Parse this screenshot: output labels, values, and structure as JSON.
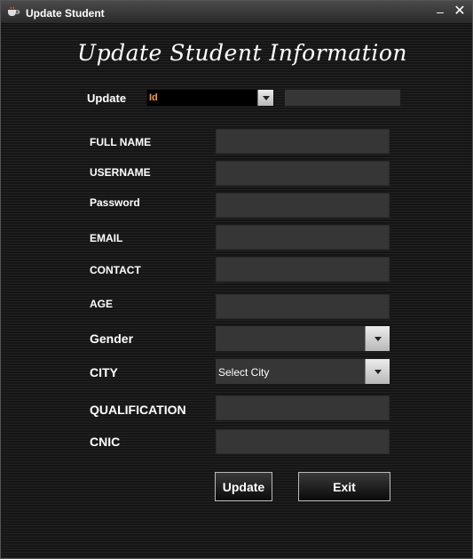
{
  "window": {
    "title": "Update Student",
    "minimize_glyph": "–",
    "close_glyph": "✕"
  },
  "form": {
    "heading": "Update Student Information",
    "search": {
      "label": "Update",
      "selected": "Id",
      "value": ""
    },
    "fields": {
      "full_name": {
        "label": "FULL NAME",
        "value": ""
      },
      "username": {
        "label": "USERNAME",
        "value": ""
      },
      "password": {
        "label": "Password",
        "value": ""
      },
      "email": {
        "label": "EMAIL",
        "value": ""
      },
      "contact": {
        "label": "CONTACT",
        "value": ""
      },
      "age": {
        "label": "AGE",
        "value": ""
      },
      "gender": {
        "label": "Gender",
        "selected": ""
      },
      "city": {
        "label": "CITY",
        "selected": "Select City"
      },
      "qualification": {
        "label": "QUALIFICATION",
        "value": ""
      },
      "cnic": {
        "label": "CNIC",
        "value": ""
      }
    },
    "buttons": {
      "update": "Update",
      "exit": "Exit"
    }
  },
  "colors": {
    "id_text": "#ff9933",
    "field_bg": "#363636"
  },
  "icons": {
    "app": "java-cup-icon",
    "dropdown": "chevron-down-icon"
  }
}
